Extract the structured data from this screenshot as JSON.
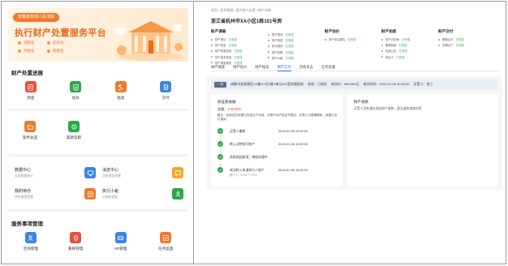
{
  "left": {
    "banner": {
      "tag": "安徽省有线人民法院",
      "title": "执行财产处置服务平台",
      "features": [
        "流程化",
        "信息化",
        "可视化",
        "智能化"
      ]
    },
    "sections": [
      {
        "title": "财产处置进展",
        "tiles": [
          {
            "label": "调查",
            "color": "#e8513b",
            "icon": "clipboard-icon"
          },
          {
            "label": "估价",
            "color": "#2aa84a",
            "icon": "chart-doc-icon"
          },
          {
            "label": "拍卖",
            "color": "#f07a2a",
            "icon": "gavel-icon"
          },
          {
            "label": "交付",
            "color": "#3a86e6",
            "icon": "handover-icon"
          }
        ]
      },
      {
        "title": "",
        "tiles": [
          {
            "label": "案件总览",
            "color": "#f07a2a",
            "icon": "folder-icon"
          },
          {
            "label": "案款追踪",
            "color": "#2aa84a",
            "icon": "money-icon"
          }
        ]
      }
    ],
    "cards": [
      {
        "title": "数据中心",
        "subtitle": "全面数据统计",
        "color": "#3a86e6",
        "icon": "monitor-icon"
      },
      {
        "title": "消息中心",
        "subtitle": "消息推送提醒",
        "color": "#f5a623",
        "icon": "message-icon"
      },
      {
        "title": "我的待办",
        "subtitle": "待办事项提醒",
        "color": "#f07a2a",
        "icon": "todo-icon"
      },
      {
        "title": "执行小秘",
        "subtitle": "AI智能客服",
        "color": "#2aa84a",
        "icon": "robot-icon"
      }
    ],
    "service": {
      "title": "服务事项管理",
      "tiles": [
        {
          "label": "咨询管理",
          "color": "#3a86e6",
          "icon": "consult-icon"
        },
        {
          "label": "看样管理",
          "color": "#e8513b",
          "icon": "location-icon"
        },
        {
          "label": "VR管理",
          "color": "#3a86e6",
          "icon": "vr-icon"
        },
        {
          "label": "任务监督",
          "color": "#f07a2a",
          "icon": "task-icon"
        }
      ]
    }
  },
  "right": {
    "breadcrumb": "首页 / 案件管理 / 案件财产处置 / 财产详情",
    "title": "浙江省杭州市XX小区1栋101号房",
    "columns": [
      {
        "title": "财产调查",
        "rows": [
          {
            "text": "财产登记",
            "value": "已完成"
          },
          {
            "text": "财产信息",
            "value": "已完成"
          },
          {
            "text": "财产权属信息",
            "value": "已完成"
          },
          {
            "text": "财产查封信息",
            "value": "已完成"
          },
          {
            "text": "财产调查报告",
            "value": "已完成"
          }
        ]
      },
      {
        "title": "",
        "rows": [
          {
            "text": "财产现状",
            "value": "已完成"
          },
          {
            "text": "财产风险",
            "value": "已完成"
          },
          {
            "text": "执行程序",
            "value": "已完成"
          },
          {
            "text": "财产处置",
            "value": "已完成"
          },
          {
            "text": "财产价值",
            "value": "已完成"
          }
        ]
      },
      {
        "title": "财产估价",
        "rows": [
          {
            "text": "资产评估报告",
            "value": "已完成"
          }
        ]
      },
      {
        "title": "财产拍卖",
        "rows": [
          {
            "text": "财产已拍卖",
            "value": "已完成"
          },
          {
            "text": "撤销拍卖",
            "value": "已完成"
          },
          {
            "text": "拍卖公告",
            "value": "已完成"
          },
          {
            "text": "竞买人",
            "value": "已完成"
          }
        ]
      },
      {
        "title": "财产交付",
        "rows": [
          {
            "text": "腾退交付",
            "value": "已完成"
          },
          {
            "text": "办理过户",
            "value": "已完成"
          }
        ]
      }
    ],
    "tabs": [
      {
        "label": "财产调查",
        "active": false
      },
      {
        "label": "财产估价",
        "active": false
      },
      {
        "label": "财产拍卖",
        "active": false
      },
      {
        "label": "财产交付",
        "active": true
      },
      {
        "label": "咨询日志",
        "active": false
      },
      {
        "label": "任务监督",
        "active": false
      }
    ],
    "infobar": {
      "badge": "一拍",
      "text": "成都市龙泉驿区XX路XX号2栋2单元601室房屋拍卖",
      "status_label": "状态：已成交",
      "price": "成交价：580,000元",
      "time": "成交时间：2024-01-06 10:00:00",
      "person": "买受人：张三"
    },
    "card1": {
      "title": "拆证款进展",
      "amount_label": "金额：",
      "amount": "¥ 80,000",
      "note": "备注：拍卖成交房屋已完成过户手续，办理不动产权证书登记，买受人已缴清尾款，房屋已交付使用",
      "steps": [
        {
          "name": "买受人缴款",
          "time": "2024-01-06 10:00:00",
          "sub": ""
        },
        {
          "name": "转入法院执行账户",
          "time": "2024-01-06 10:00:00",
          "sub": ""
        },
        {
          "name": "系统发起款项，审核办理中",
          "time": "",
          "sub": ""
        },
        {
          "name": "成功转入申请执行人账户",
          "time": "2024-01-06 10:00:00",
          "sub": "银行卡：6226****7253"
        }
      ]
    },
    "card2": {
      "title": "财产退款",
      "text": "买受人没有通过发起财产退款，暂无退款进度信息"
    }
  }
}
